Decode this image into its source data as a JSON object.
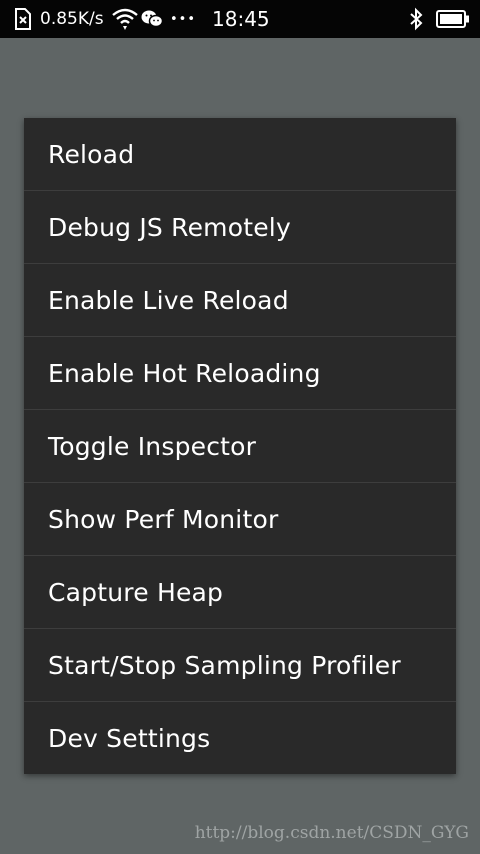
{
  "status_bar": {
    "network_speed": "0.85K/s",
    "time": "18:45",
    "more_dots": "•••",
    "icons": [
      "sim-x-icon",
      "wifi-icon",
      "wechat-icon",
      "bluetooth-icon",
      "battery-icon"
    ],
    "battery_level": 1.0
  },
  "dev_menu": {
    "items": [
      {
        "label": "Reload"
      },
      {
        "label": "Debug JS Remotely"
      },
      {
        "label": "Enable Live Reload"
      },
      {
        "label": "Enable Hot Reloading"
      },
      {
        "label": "Toggle Inspector"
      },
      {
        "label": "Show Perf Monitor"
      },
      {
        "label": "Capture Heap"
      },
      {
        "label": "Start/Stop Sampling Profiler"
      },
      {
        "label": "Dev Settings"
      }
    ]
  },
  "watermark": "http://blog.csdn.net/CSDN_GYG",
  "colors": {
    "overlay_background": "#5f6565",
    "menu_background": "#292929",
    "divider": "#3d3d3d",
    "status_bar": "#050505",
    "text": "#ffffff"
  }
}
